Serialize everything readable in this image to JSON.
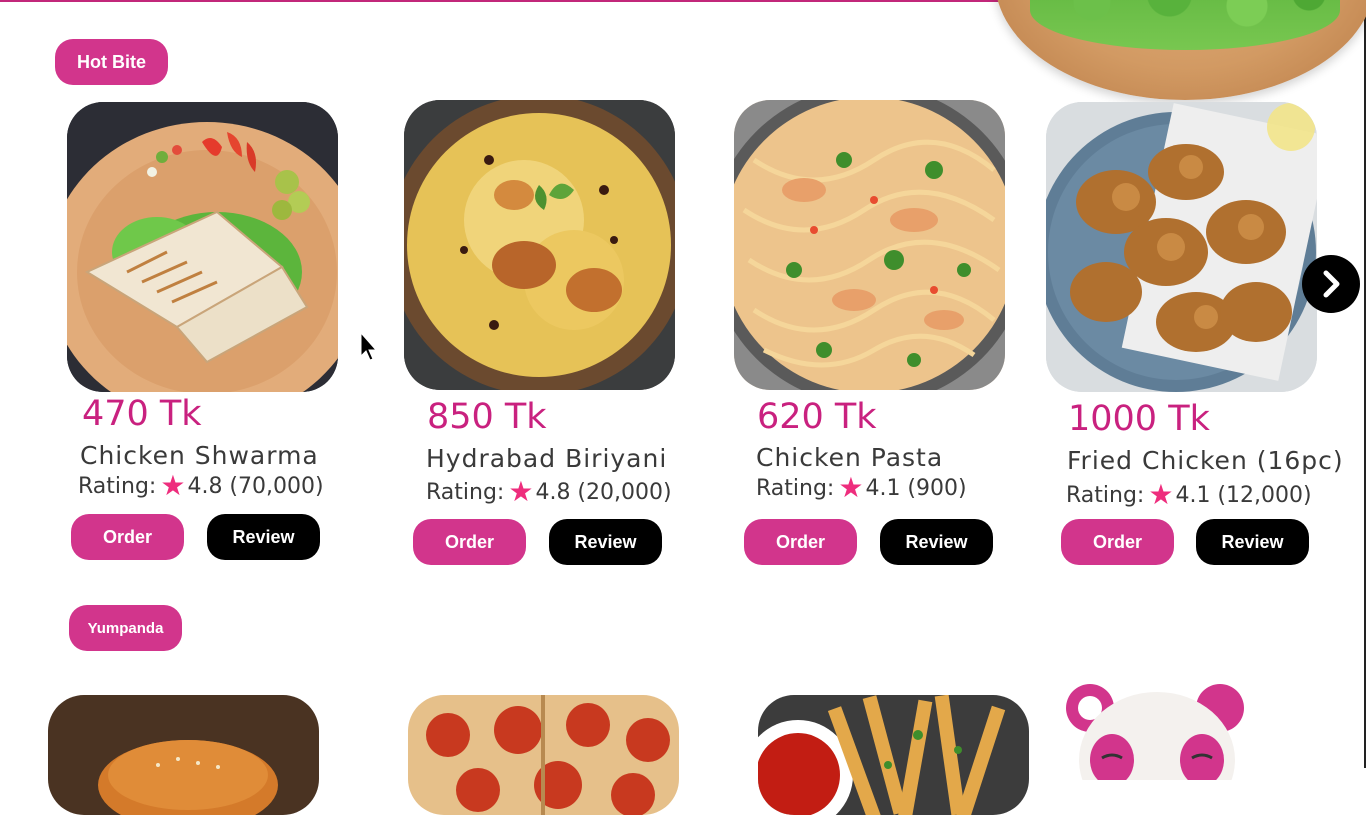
{
  "sections": {
    "hot_bite": "Hot Bite",
    "yumpanda": "Yumpanda"
  },
  "products": [
    {
      "price": "470 Tk",
      "name": "Chicken Shwarma",
      "rating_label": "Rating:",
      "rating": "4.8 (70,000)",
      "order": "Order",
      "review": "Review"
    },
    {
      "price": "850 Tk",
      "name": "Hydrabad Biriyani",
      "rating_label": "Rating:",
      "rating": "4.8 (20,000)",
      "order": "Order",
      "review": "Review"
    },
    {
      "price": "620 Tk",
      "name": "Chicken Pasta",
      "rating_label": "Rating:",
      "rating": "4.1 (900)",
      "order": "Order",
      "review": "Review"
    },
    {
      "price": "1000 Tk",
      "name": "Fried Chicken (16pc)",
      "rating_label": "Rating:",
      "rating": "4.1 (12,000)",
      "order": "Order",
      "review": "Review"
    }
  ],
  "icons": {
    "next": "chevron-right-icon",
    "star": "star-icon"
  },
  "colors": {
    "accent": "#d2358c",
    "price": "#c9217f",
    "star": "#ee2d7d",
    "dark": "#000000"
  }
}
